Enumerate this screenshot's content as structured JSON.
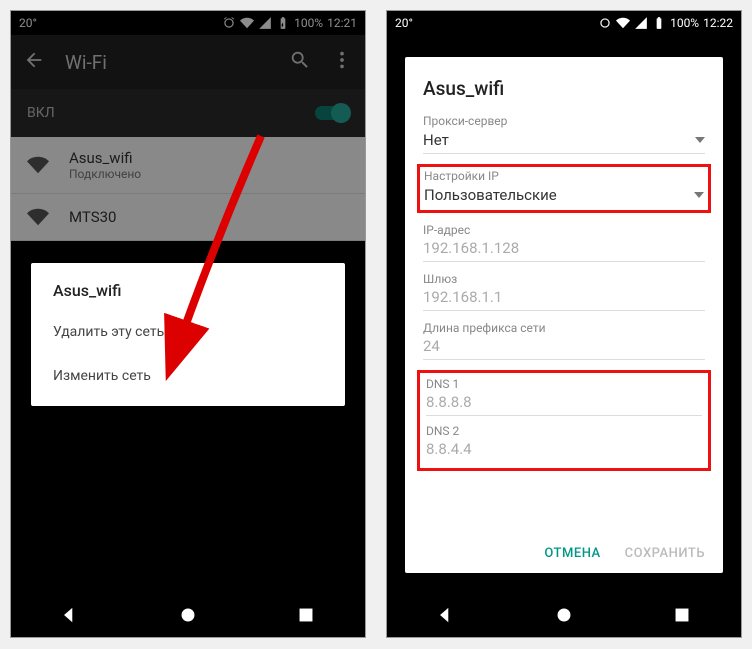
{
  "left": {
    "status": {
      "temp": "20°",
      "battery": "100%",
      "time": "12:21"
    },
    "appbar": {
      "title": "Wi-Fi"
    },
    "toggle_label": "ВКЛ",
    "networks": [
      {
        "name": "Asus_wifi",
        "status": "Подключено"
      },
      {
        "name": "MTS30",
        "status": ""
      }
    ],
    "context": {
      "title": "Asus_wifi",
      "delete": "Удалить эту сеть",
      "modify": "Изменить сеть"
    }
  },
  "right": {
    "status": {
      "temp": "20°",
      "battery": "100%",
      "time": "12:22"
    },
    "dialog": {
      "title": "Asus_wifi",
      "proxy_label": "Прокси-сервер",
      "proxy_value": "Нет",
      "ip_settings_label": "Настройки IP",
      "ip_settings_value": "Пользовательские",
      "ip_label": "IP-адрес",
      "ip_value": "192.168.1.128",
      "gateway_label": "Шлюз",
      "gateway_value": "192.168.1.1",
      "prefix_label": "Длина префикса сети",
      "prefix_value": "24",
      "dns1_label": "DNS 1",
      "dns1_value": "8.8.8.8",
      "dns2_label": "DNS 2",
      "dns2_value": "8.8.4.4",
      "cancel": "ОТМЕНА",
      "save": "СОХРАНИТЬ"
    }
  }
}
